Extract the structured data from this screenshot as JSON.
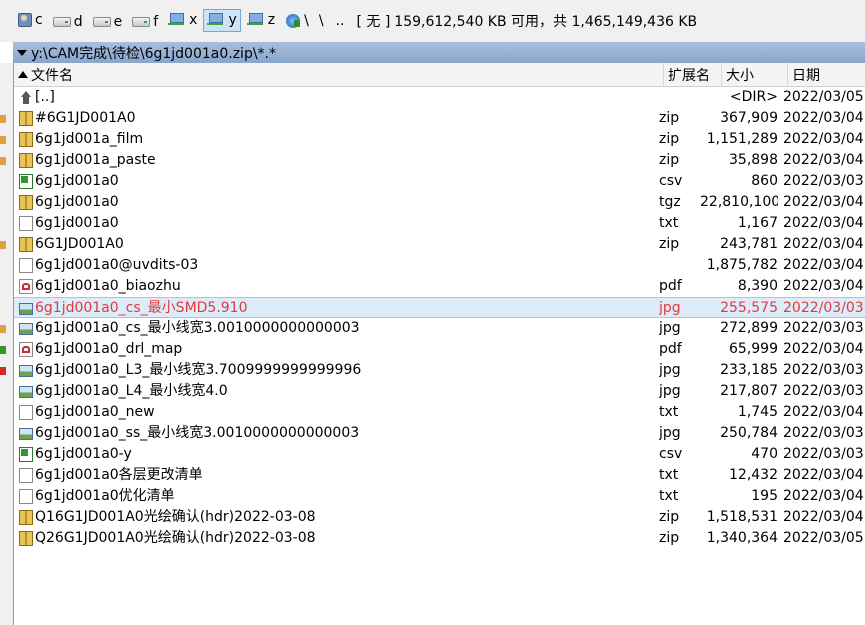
{
  "drives": [
    {
      "letter": "c",
      "icon": "user-drive-icon"
    },
    {
      "letter": "d",
      "icon": "hard-drive-icon"
    },
    {
      "letter": "e",
      "icon": "hard-drive-icon"
    },
    {
      "letter": "f",
      "icon": "hard-drive-icon"
    },
    {
      "letter": "x",
      "icon": "network-drive-icon"
    },
    {
      "letter": "y",
      "icon": "network-drive-icon",
      "active": true
    },
    {
      "letter": "z",
      "icon": "network-drive-icon"
    }
  ],
  "toolbar": {
    "root_label": "\\",
    "backslash_label": "\\",
    "updir_label": "..",
    "volume_label": "[ 无 ]",
    "free_space": "159,612,540 KB 可用，共 1,465,149,436 KB"
  },
  "path": "y:\\CAM完成\\待检\\6g1jd001a0.zip\\*.*",
  "columns": {
    "name": "文件名",
    "ext": "扩展名",
    "size": "大小",
    "date": "日期"
  },
  "files": [
    {
      "name": "[..]",
      "ext": "",
      "size": "<DIR>",
      "date": "2022/03/05",
      "icon": "up"
    },
    {
      "name": "#6G1JD001A0",
      "ext": "zip",
      "size": "367,909",
      "date": "2022/03/04",
      "icon": "zip"
    },
    {
      "name": "6g1jd001a_film",
      "ext": "zip",
      "size": "1,151,289",
      "date": "2022/03/04",
      "icon": "zip"
    },
    {
      "name": "6g1jd001a_paste",
      "ext": "zip",
      "size": "35,898",
      "date": "2022/03/04",
      "icon": "zip"
    },
    {
      "name": "6g1jd001a0",
      "ext": "csv",
      "size": "860",
      "date": "2022/03/03",
      "icon": "csv"
    },
    {
      "name": "6g1jd001a0",
      "ext": "tgz",
      "size": "22,810,100",
      "date": "2022/03/04",
      "icon": "zip"
    },
    {
      "name": "6g1jd001a0",
      "ext": "txt",
      "size": "1,167",
      "date": "2022/03/04",
      "icon": "txt"
    },
    {
      "name": "6G1JD001A0",
      "ext": "zip",
      "size": "243,781",
      "date": "2022/03/04",
      "icon": "zip"
    },
    {
      "name": "6g1jd001a0@uvdits-03",
      "ext": "",
      "size": "1,875,782",
      "date": "2022/03/04",
      "icon": "blank"
    },
    {
      "name": "6g1jd001a0_biaozhu",
      "ext": "pdf",
      "size": "8,390",
      "date": "2022/03/04",
      "icon": "pdf"
    },
    {
      "name": "6g1jd001a0_cs_最小SMD5.910",
      "ext": "jpg",
      "size": "255,575",
      "date": "2022/03/03",
      "icon": "jpg",
      "selected": true
    },
    {
      "name": "6g1jd001a0_cs_最小线宽3.0010000000000003",
      "ext": "jpg",
      "size": "272,899",
      "date": "2022/03/03",
      "icon": "jpg"
    },
    {
      "name": "6g1jd001a0_drl_map",
      "ext": "pdf",
      "size": "65,999",
      "date": "2022/03/04",
      "icon": "pdf"
    },
    {
      "name": "6g1jd001a0_L3_最小线宽3.7009999999999996",
      "ext": "jpg",
      "size": "233,185",
      "date": "2022/03/03",
      "icon": "jpg"
    },
    {
      "name": "6g1jd001a0_L4_最小线宽4.0",
      "ext": "jpg",
      "size": "217,807",
      "date": "2022/03/03",
      "icon": "jpg"
    },
    {
      "name": "6g1jd001a0_new",
      "ext": "txt",
      "size": "1,745",
      "date": "2022/03/04",
      "icon": "txt"
    },
    {
      "name": "6g1jd001a0_ss_最小线宽3.0010000000000003",
      "ext": "jpg",
      "size": "250,784",
      "date": "2022/03/03",
      "icon": "jpg"
    },
    {
      "name": "6g1jd001a0-y",
      "ext": "csv",
      "size": "470",
      "date": "2022/03/03",
      "icon": "csv"
    },
    {
      "name": "6g1jd001a0各层更改清单",
      "ext": "txt",
      "size": "12,432",
      "date": "2022/03/04",
      "icon": "txt"
    },
    {
      "name": "6g1jd001a0优化清单",
      "ext": "txt",
      "size": "195",
      "date": "2022/03/04",
      "icon": "txt"
    },
    {
      "name": "Q16G1JD001A0光绘确认(hdr)2022-03-08",
      "ext": "zip",
      "size": "1,518,531",
      "date": "2022/03/04",
      "icon": "zip"
    },
    {
      "name": "Q26G1JD001A0光绘确认(hdr)2022-03-08",
      "ext": "zip",
      "size": "1,340,364",
      "date": "2022/03/05",
      "icon": "zip"
    }
  ],
  "colors": {
    "selected_text": "#e23a3a",
    "selected_bg": "#dcecfb",
    "path_bar": "#9fb6d6"
  }
}
